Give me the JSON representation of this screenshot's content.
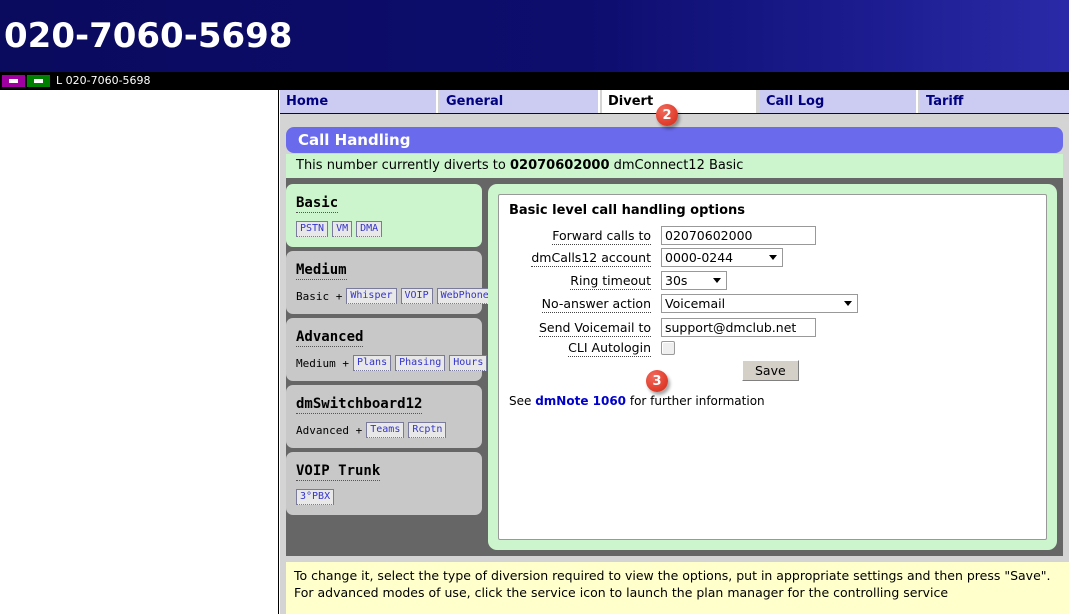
{
  "banner": {
    "title": "020-7060-5698"
  },
  "statusbar": {
    "text": "L 020-7060-5698",
    "icons": [
      {
        "name": "purple-service-icon",
        "color": "#a000a0"
      },
      {
        "name": "green-service-icon",
        "color": "#008000"
      }
    ]
  },
  "tabs": [
    {
      "label": "Home",
      "active": false
    },
    {
      "label": "General",
      "active": false
    },
    {
      "label": "Divert",
      "active": true
    },
    {
      "label": "Call Log",
      "active": false
    },
    {
      "label": "Tariff",
      "active": false
    }
  ],
  "step_badges": {
    "tab_badge": "2",
    "save_badge": "3"
  },
  "panel": {
    "header": "Call Handling",
    "status_prefix": "This number currently diverts to ",
    "status_number": "02070602000",
    "status_suffix": " dmConnect12 Basic"
  },
  "levels": [
    {
      "title": "Basic",
      "prefix": "",
      "chips": [
        "PSTN",
        "VM",
        "DMA"
      ],
      "selected": true
    },
    {
      "title": "Medium",
      "prefix": "Basic +",
      "chips": [
        "Whisper",
        "VOIP",
        "WebPhone"
      ],
      "selected": false
    },
    {
      "title": "Advanced",
      "prefix": "Medium +",
      "chips": [
        "Plans",
        "Phasing",
        "Hours"
      ],
      "selected": false
    },
    {
      "title": "dmSwitchboard12",
      "prefix": "Advanced +",
      "chips": [
        "Teams",
        "Rcptn"
      ],
      "selected": false
    },
    {
      "title": "VOIP Trunk",
      "prefix": "",
      "chips": [
        "3°PBX"
      ],
      "selected": false
    }
  ],
  "form": {
    "title": "Basic level call handling options",
    "fields": {
      "forward_label": "Forward calls to",
      "forward_value": "02070602000",
      "account_label": "dmCalls12 account",
      "account_value": "0000-0244",
      "ring_label": "Ring timeout",
      "ring_value": "30s",
      "noanswer_label": "No-answer action",
      "noanswer_value": "Voicemail",
      "voicemail_label": "Send Voicemail to",
      "voicemail_value": "support@dmclub.net",
      "cli_label": "CLI Autologin",
      "cli_checked": false
    },
    "save_label": "Save",
    "note_prefix": "See ",
    "note_link": "dmNote 1060",
    "note_suffix": " for further information"
  },
  "help": {
    "line1": "To change it, select the type of diversion required to view the options, put in appropriate settings and then press \"Save\".",
    "line2": "For advanced modes of use, click the service icon to launch the plan manager for the controlling service"
  },
  "colors": {
    "banner": "#0d0d6b",
    "tab": "#ccccf2",
    "panel_header": "#6a6aec",
    "selected_green": "#cdf5cd",
    "help_yellow": "#ffffcc",
    "badge_red": "#e2402f"
  }
}
